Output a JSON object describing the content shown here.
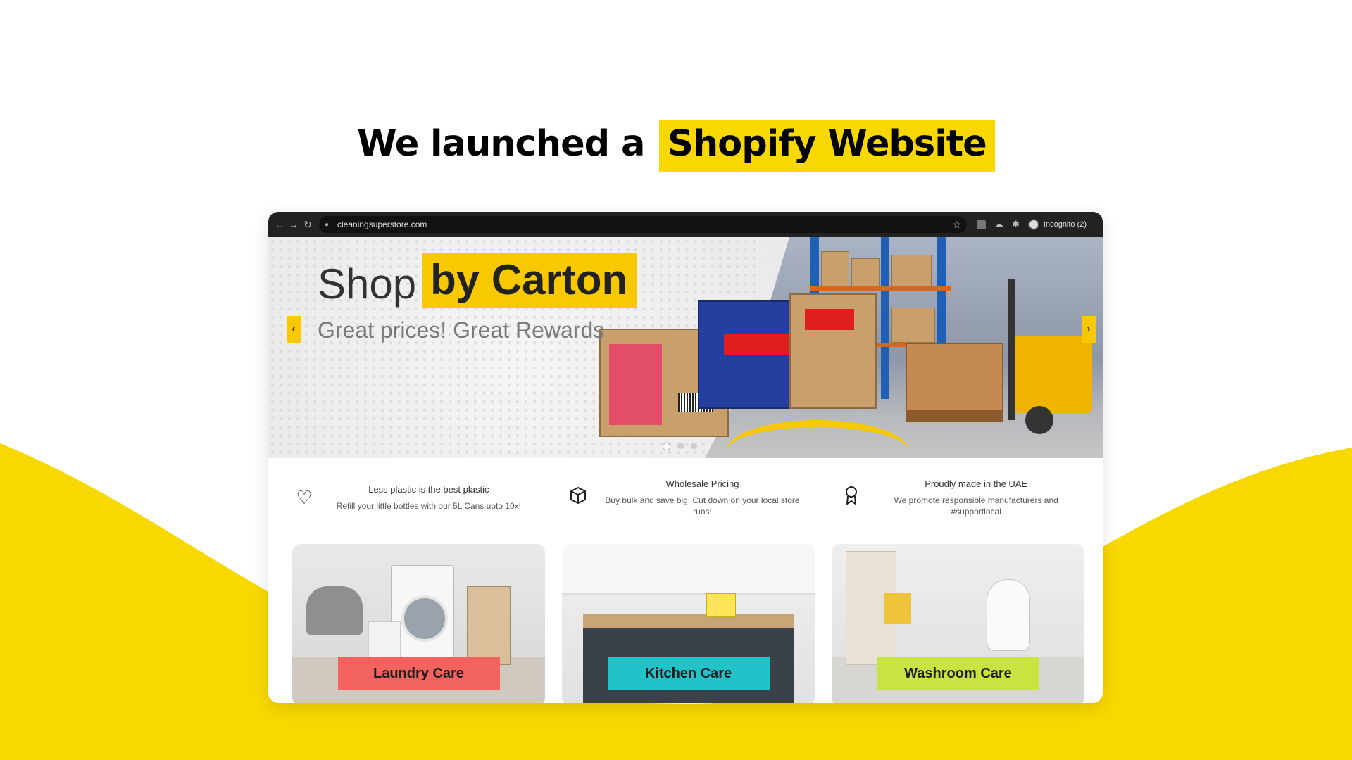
{
  "slide": {
    "headline_prefix": "We launched a",
    "headline_highlight": "Shopify Website",
    "accent_color": "#f8d800"
  },
  "browser": {
    "url": "cleaningsuperstore.com",
    "profile_label": "Incognito (2)"
  },
  "hero": {
    "title_plain": "Shop",
    "title_highlight": "by Carton",
    "subtitle": "Great prices! Great Rewards",
    "accent_color": "#f8c800"
  },
  "features": [
    {
      "icon": "heart-icon",
      "title": "Less plastic is the best plastic",
      "desc": "Refill your little bottles with our 5L Cans upto 10x!"
    },
    {
      "icon": "box-icon",
      "title": "Wholesale Pricing",
      "desc": "Buy bulk and save big. Cut down on your local store runs!"
    },
    {
      "icon": "award-icon",
      "title": "Proudly made in the UAE",
      "desc": "We promote responsible manufacturers and #supportlocal"
    }
  ],
  "categories": [
    {
      "label": "Laundry Care",
      "color": "#f2625e"
    },
    {
      "label": "Kitchen Care",
      "color": "#22c2c9"
    },
    {
      "label": "Washroom Care",
      "color": "#c9e340"
    }
  ]
}
